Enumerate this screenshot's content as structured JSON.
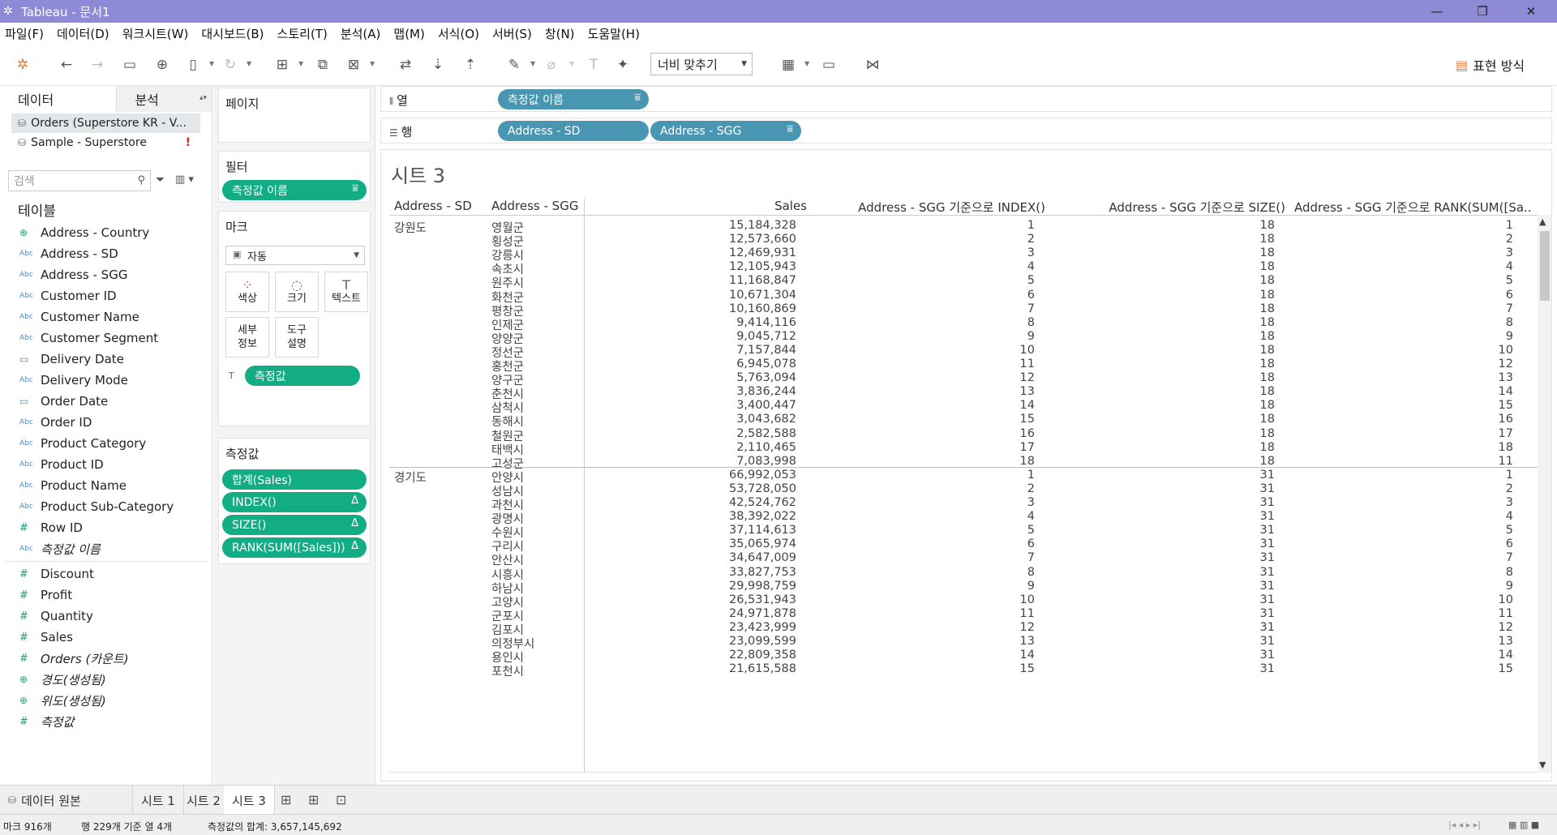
{
  "window": {
    "title": "Tableau - 문서1",
    "minimize": "—",
    "restore": "❐",
    "close": "✕"
  },
  "menu": [
    "파일(F)",
    "데이터(D)",
    "워크시트(W)",
    "대시보드(B)",
    "스토리(T)",
    "분석(A)",
    "맵(M)",
    "서식(O)",
    "서버(S)",
    "창(N)",
    "도움말(H)"
  ],
  "toolbar": {
    "fit_label": "너비 맞추기",
    "show_me_label": "표현 방식"
  },
  "data_pane": {
    "tab_data": "데이터",
    "tab_analysis": "분석",
    "sources": [
      {
        "label": "Orders (Superstore KR - V..."
      },
      {
        "label": "Sample - Superstore",
        "warning": "!"
      }
    ],
    "search_placeholder": "검색",
    "tables_header": "테이블",
    "dimensions": [
      {
        "type": "geo",
        "name": "Address - Country"
      },
      {
        "type": "abc",
        "name": "Address - SD"
      },
      {
        "type": "abc",
        "name": "Address - SGG"
      },
      {
        "type": "abc",
        "name": "Customer ID"
      },
      {
        "type": "abc",
        "name": "Customer Name"
      },
      {
        "type": "abc",
        "name": "Customer Segment"
      },
      {
        "type": "date",
        "name": "Delivery Date"
      },
      {
        "type": "abc",
        "name": "Delivery Mode"
      },
      {
        "type": "date",
        "name": "Order Date"
      },
      {
        "type": "abc",
        "name": "Order ID"
      },
      {
        "type": "abc",
        "name": "Product Category"
      },
      {
        "type": "abc",
        "name": "Product ID"
      },
      {
        "type": "abc",
        "name": "Product Name"
      },
      {
        "type": "abc",
        "name": "Product Sub-Category"
      },
      {
        "type": "num",
        "name": "Row ID"
      },
      {
        "type": "abc",
        "name": "측정값 이름",
        "italic": true
      }
    ],
    "measures": [
      {
        "type": "num",
        "name": "Discount"
      },
      {
        "type": "num",
        "name": "Profit"
      },
      {
        "type": "num",
        "name": "Quantity"
      },
      {
        "type": "num",
        "name": "Sales"
      },
      {
        "type": "num",
        "name": "Orders (카운트)",
        "italic": true
      },
      {
        "type": "geo",
        "name": "경도(생성됨)",
        "italic": true
      },
      {
        "type": "geo",
        "name": "위도(생성됨)",
        "italic": true
      },
      {
        "type": "num",
        "name": "측정값",
        "italic": true
      }
    ],
    "type_glyphs": {
      "abc": "Abc",
      "num": "#",
      "date": "▭",
      "geo": "⊕"
    }
  },
  "cards": {
    "pages_title": "페이지",
    "filters_title": "필터",
    "filter_pill": "측정값 이름",
    "marks_title": "마크",
    "marks_type": "자동",
    "mark_color": "색상",
    "mark_size": "크기",
    "mark_text": "텍스트",
    "mark_detail_1": "세부",
    "mark_detail_2": "정보",
    "mark_tooltip_1": "도구",
    "mark_tooltip_2": "설명",
    "marks_pill": "측정값",
    "measures_title": "측정값",
    "measure_pills": [
      "합계(Sales)",
      "INDEX()",
      "SIZE()",
      "RANK(SUM([Sales]))"
    ],
    "delta_glyph": "Δ"
  },
  "shelves": {
    "columns_label": "열",
    "columns_pill": "측정값 이름",
    "rows_label": "행",
    "rows_pills": [
      "Address - SD",
      "Address - SGG"
    ]
  },
  "sheet": {
    "title": "시트 3",
    "headers": {
      "sd": "Address - SD",
      "sgg": "Address - SGG",
      "sales": "Sales",
      "index": "Address - SGG 기준으로 INDEX()",
      "size": "Address - SGG 기준으로 SIZE()",
      "rank": "Address - SGG 기준으로 RANK(SUM([Sa.."
    },
    "groups": [
      {
        "sd": "강원도",
        "rows": [
          [
            "영월군",
            "15,184,328",
            "1",
            "18",
            "1"
          ],
          [
            "횡성군",
            "12,573,660",
            "2",
            "18",
            "2"
          ],
          [
            "강릉시",
            "12,469,931",
            "3",
            "18",
            "3"
          ],
          [
            "속초시",
            "12,105,943",
            "4",
            "18",
            "4"
          ],
          [
            "원주시",
            "11,168,847",
            "5",
            "18",
            "5"
          ],
          [
            "화천군",
            "10,671,304",
            "6",
            "18",
            "6"
          ],
          [
            "평창군",
            "10,160,869",
            "7",
            "18",
            "7"
          ],
          [
            "인제군",
            "9,414,116",
            "8",
            "18",
            "8"
          ],
          [
            "양양군",
            "9,045,712",
            "9",
            "18",
            "9"
          ],
          [
            "정선군",
            "7,157,844",
            "10",
            "18",
            "10"
          ],
          [
            "홍천군",
            "6,945,078",
            "11",
            "18",
            "12"
          ],
          [
            "양구군",
            "5,763,094",
            "12",
            "18",
            "13"
          ],
          [
            "춘천시",
            "3,836,244",
            "13",
            "18",
            "14"
          ],
          [
            "삼척시",
            "3,400,447",
            "14",
            "18",
            "15"
          ],
          [
            "동해시",
            "3,043,682",
            "15",
            "18",
            "16"
          ],
          [
            "철원군",
            "2,582,588",
            "16",
            "18",
            "17"
          ],
          [
            "태백시",
            "2,110,465",
            "17",
            "18",
            "18"
          ],
          [
            "고성군",
            "7,083,998",
            "18",
            "18",
            "11"
          ]
        ]
      },
      {
        "sd": "경기도",
        "rows": [
          [
            "안양시",
            "66,992,053",
            "1",
            "31",
            "1"
          ],
          [
            "성남시",
            "53,728,050",
            "2",
            "31",
            "2"
          ],
          [
            "과천시",
            "42,524,762",
            "3",
            "31",
            "3"
          ],
          [
            "광명시",
            "38,392,022",
            "4",
            "31",
            "4"
          ],
          [
            "수원시",
            "37,114,613",
            "5",
            "31",
            "5"
          ],
          [
            "구리시",
            "35,065,974",
            "6",
            "31",
            "6"
          ],
          [
            "안산시",
            "34,647,009",
            "7",
            "31",
            "7"
          ],
          [
            "시흥시",
            "33,827,753",
            "8",
            "31",
            "8"
          ],
          [
            "하남시",
            "29,998,759",
            "9",
            "31",
            "9"
          ],
          [
            "고양시",
            "26,531,943",
            "10",
            "31",
            "10"
          ],
          [
            "군포시",
            "24,971,878",
            "11",
            "31",
            "11"
          ],
          [
            "김포시",
            "23,423,999",
            "12",
            "31",
            "12"
          ],
          [
            "의정부시",
            "23,099,599",
            "13",
            "31",
            "13"
          ],
          [
            "용인시",
            "22,809,358",
            "14",
            "31",
            "14"
          ],
          [
            "포천시",
            "21,615,588",
            "15",
            "31",
            "15"
          ]
        ]
      }
    ]
  },
  "bottom_tabs": {
    "data_source": "데이터 원본",
    "sheets": [
      "시트 1",
      "시트 2",
      "시트 3"
    ],
    "active_sheet": "시트 3"
  },
  "status": {
    "marks": "마크 916개",
    "rows_cols": "행 229개 기준 열 4개",
    "sum": "측정값의 합계: 3,657,145,692"
  },
  "colors": {
    "titlebar": "#8e8ad6",
    "measure_pill": "#12ad85",
    "dimension_pill": "#4996b2"
  }
}
